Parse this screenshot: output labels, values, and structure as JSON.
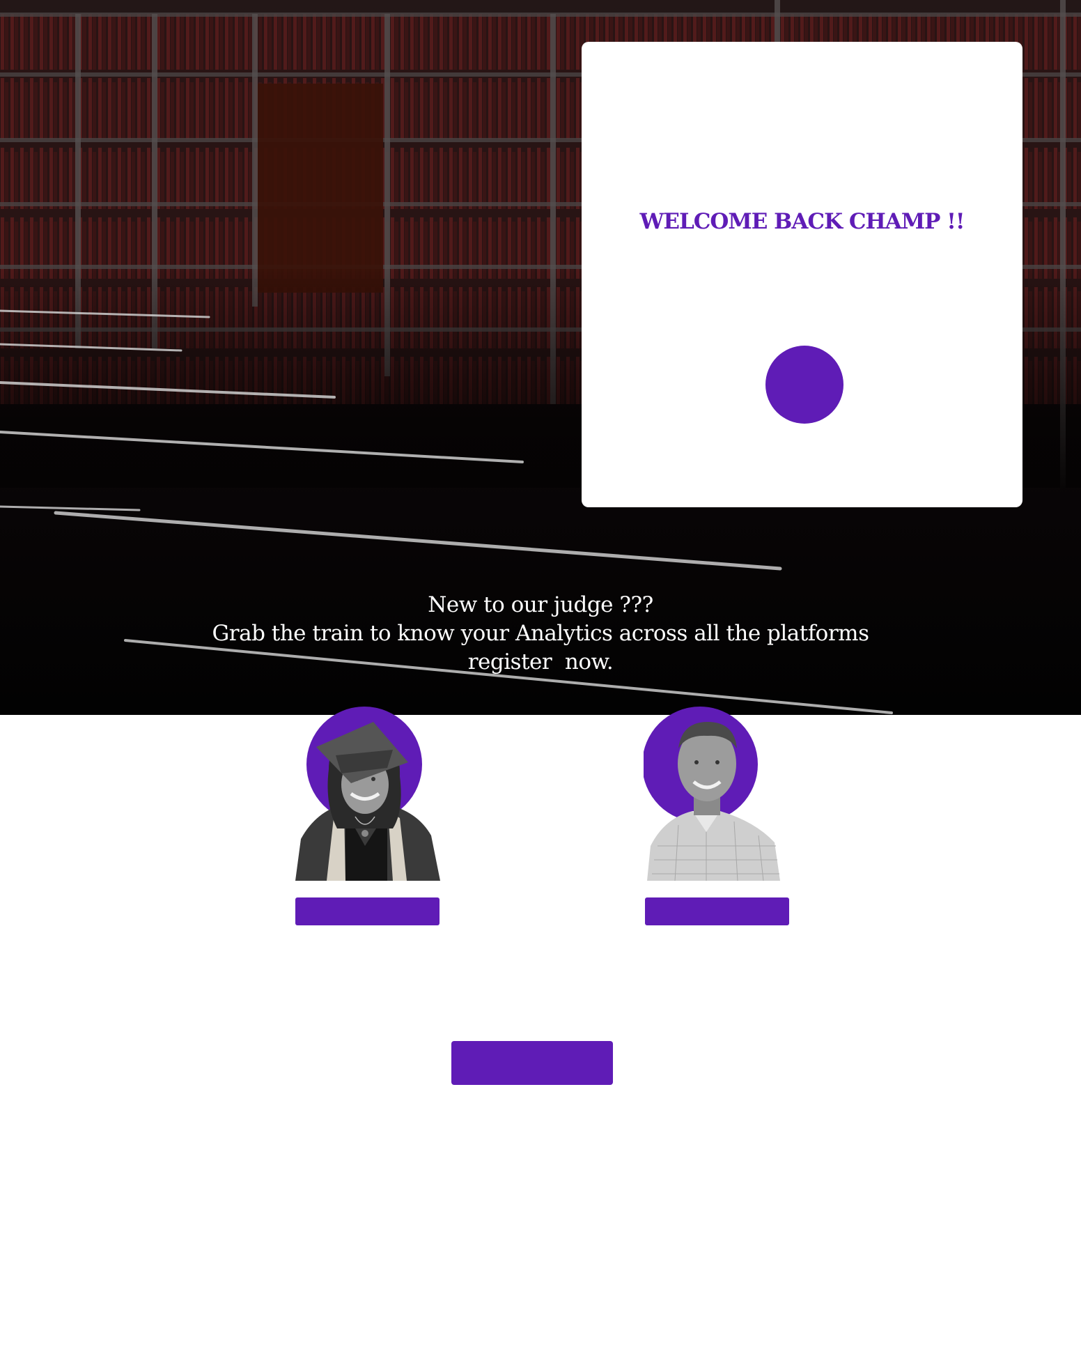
{
  "login_card": {
    "title": "WELCOME BACK CHAMP !!"
  },
  "new_user_prompt": {
    "line1": "New to our judge ???",
    "line2": "Grab the train to know your Analytics across all the platforms",
    "line3": "register  now."
  },
  "colors": {
    "accent": "#5f1cb6",
    "card_background": "#ffffff",
    "page_background": "#ffffff"
  },
  "icons": {
    "login_button": "purple-circle",
    "profile_left": "graduate-avatar",
    "profile_right": "man-avatar"
  }
}
